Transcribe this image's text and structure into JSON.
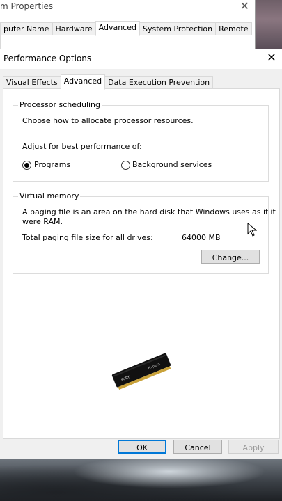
{
  "system_properties": {
    "title": "m Properties",
    "tabs": [
      "puter Name",
      "Hardware",
      "Advanced",
      "System Protection",
      "Remote"
    ],
    "selected_tab": 2
  },
  "performance_options": {
    "title": "Performance Options",
    "tabs": [
      "Visual Effects",
      "Advanced",
      "Data Execution Prevention"
    ],
    "selected_tab": 1,
    "processor_scheduling": {
      "group_label": "Processor scheduling",
      "description": "Choose how to allocate processor resources.",
      "adjust_label": "Adjust for best performance of:",
      "options": [
        {
          "label": "Programs",
          "selected": true
        },
        {
          "label": "Background services",
          "selected": false
        }
      ]
    },
    "virtual_memory": {
      "group_label": "Virtual memory",
      "description_line1": "A paging file is an area on the hard disk that Windows uses as if it",
      "description_line2": "were RAM.",
      "total_label": "Total paging file size for all drives:",
      "total_value": "64000 MB",
      "change_button": "Change..."
    },
    "ram_overlay": {
      "brand_text": "FURY",
      "brand_text2": "HyperX"
    },
    "buttons": {
      "ok": "OK",
      "cancel": "Cancel",
      "apply": "Apply"
    }
  },
  "colors": {
    "dialog_bg": "#f0f0f0",
    "panel_bg": "#ffffff",
    "default_button_border": "#0078d7"
  }
}
